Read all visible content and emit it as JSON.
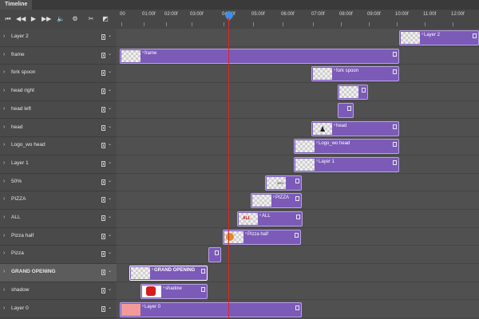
{
  "panel": {
    "tab": "Timeline"
  },
  "toolbar": {
    "icons": [
      "first-frame-icon",
      "previous-frame-icon",
      "play-icon",
      "next-frame-icon",
      "audio-icon",
      "settings-icon",
      "split-icon",
      "transition-icon"
    ]
  },
  "ruler": {
    "labels": [
      "00",
      "01:00f",
      "02:00f",
      "03:00f",
      "04:00f",
      "05:00f",
      "06:00f",
      "07:00f",
      "08:00f",
      "09:00f",
      "10:00f",
      "11:00f",
      "12:00f"
    ],
    "playhead": "04:00f"
  },
  "colors": {
    "clip": "#7b5ab8",
    "playhead": "#e02525",
    "playhead_handle": "#3d8ee8"
  },
  "layers": [
    {
      "name": "Layer 2"
    },
    {
      "name": "frame"
    },
    {
      "name": "fork spoon"
    },
    {
      "name": "head right"
    },
    {
      "name": "head left"
    },
    {
      "name": "head"
    },
    {
      "name": "Logo_wo head"
    },
    {
      "name": "Layer 1"
    },
    {
      "name": "50%"
    },
    {
      "name": "PIZZA"
    },
    {
      "name": "ALL"
    },
    {
      "name": "Pizza half"
    },
    {
      "name": "Pizza"
    },
    {
      "name": "GRAND OPENING",
      "selected": true
    },
    {
      "name": "shadow"
    },
    {
      "name": "Layer 0"
    }
  ],
  "clips": [
    {
      "label": "Layer 2"
    },
    {
      "label": "frame"
    },
    {
      "label": "fork spoon"
    },
    {
      "label": ""
    },
    {
      "label": ""
    },
    {
      "label": "head"
    },
    {
      "label": "Logo_wo head"
    },
    {
      "label": "Layer 1"
    },
    {
      "label": ""
    },
    {
      "label": "PIZZA"
    },
    {
      "label": "ALL"
    },
    {
      "label": "Pizza half"
    },
    {
      "label": ""
    },
    {
      "label": "GRAND OPENING"
    },
    {
      "label": "shadow"
    },
    {
      "label": "Layer 0"
    }
  ],
  "thumb_texts": {
    "50%": "50%",
    "ALL": "ALL"
  }
}
